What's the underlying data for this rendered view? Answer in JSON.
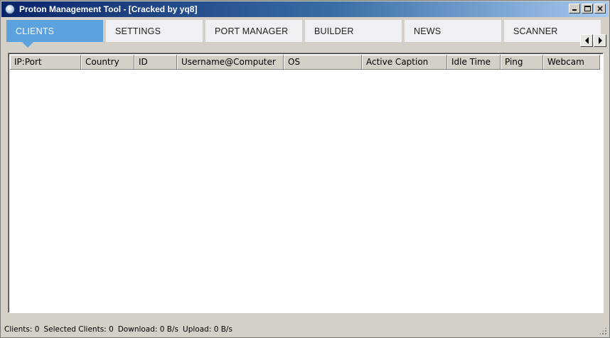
{
  "window": {
    "title": "Proton Management Tool - [Cracked by yq8]",
    "icon": "globe-icon"
  },
  "tabs": [
    {
      "label": "CLIENTS",
      "active": true
    },
    {
      "label": "SETTINGS",
      "active": false
    },
    {
      "label": "PORT MANAGER",
      "active": false
    },
    {
      "label": "BUILDER",
      "active": false
    },
    {
      "label": "NEWS",
      "active": false
    },
    {
      "label": "SCANNER",
      "active": false
    }
  ],
  "clients_table": {
    "columns": [
      "IP:Port",
      "Country",
      "ID",
      "Username@Computer",
      "OS",
      "Active Caption",
      "Idle Time",
      "Ping",
      "Webcam"
    ],
    "rows": []
  },
  "status": {
    "clients": "Clients: 0",
    "selected": "Selected Clients: 0",
    "download": "Download: 0 B/s",
    "upload": "Upload: 0 B/s"
  },
  "colors": {
    "active_tab": "#5ba2de",
    "inactive_tab": "#eef0f4",
    "chrome": "#d4d0c8"
  }
}
